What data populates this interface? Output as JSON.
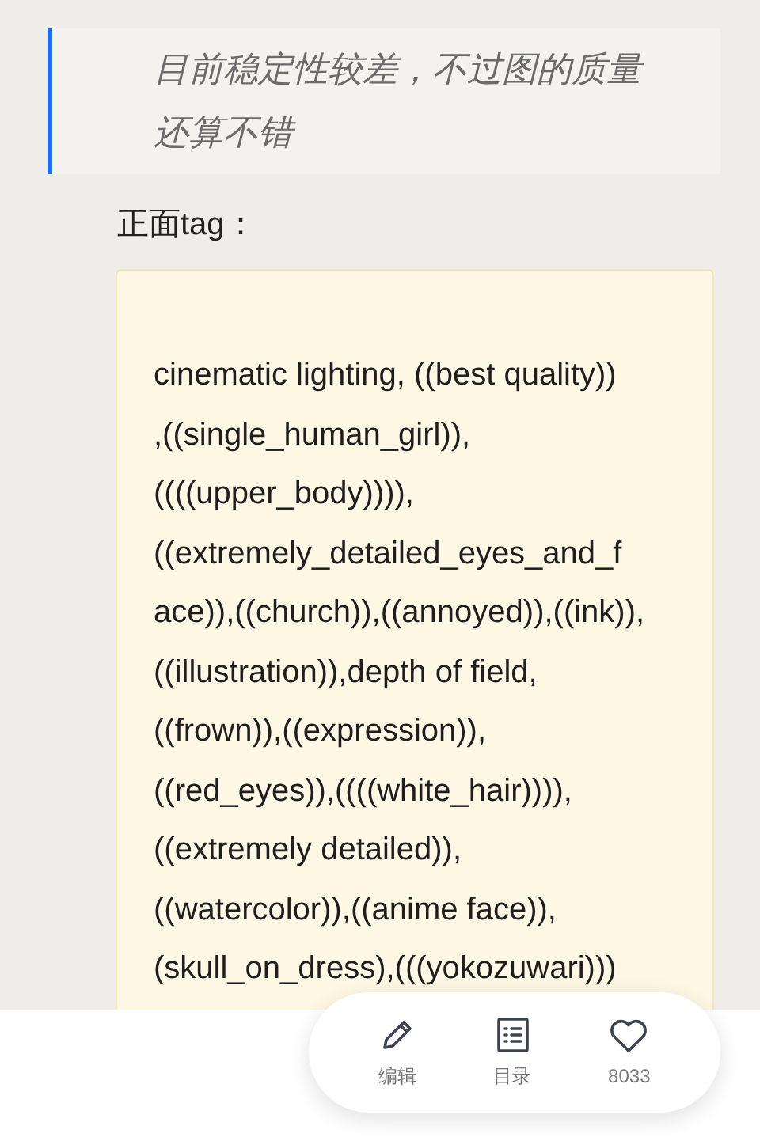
{
  "quote": {
    "text": "目前稳定性较差，不过图的质量还算不错"
  },
  "heading": "正面tag：",
  "code_block": {
    "lines": [
      "cinematic lighting, ((best quality))",
      ",((single_human_girl)),",
      "((((upper_body)))),",
      "((extremely_detailed_eyes_and_f",
      "ace)),((church)),((annoyed)),((ink)),",
      "((illustration)),depth of field,",
      "((frown)),((expression)),",
      "((red_eyes)),((((white_hair)))),",
      "((extremely detailed)),",
      "((watercolor)),((anime face)),",
      "(skull_on_dress),(((yokozuwari)))"
    ]
  },
  "action_bar": [
    {
      "kind": "edit",
      "label": "编辑"
    },
    {
      "kind": "toc",
      "label": "目录"
    },
    {
      "kind": "like",
      "label": "8033"
    }
  ]
}
